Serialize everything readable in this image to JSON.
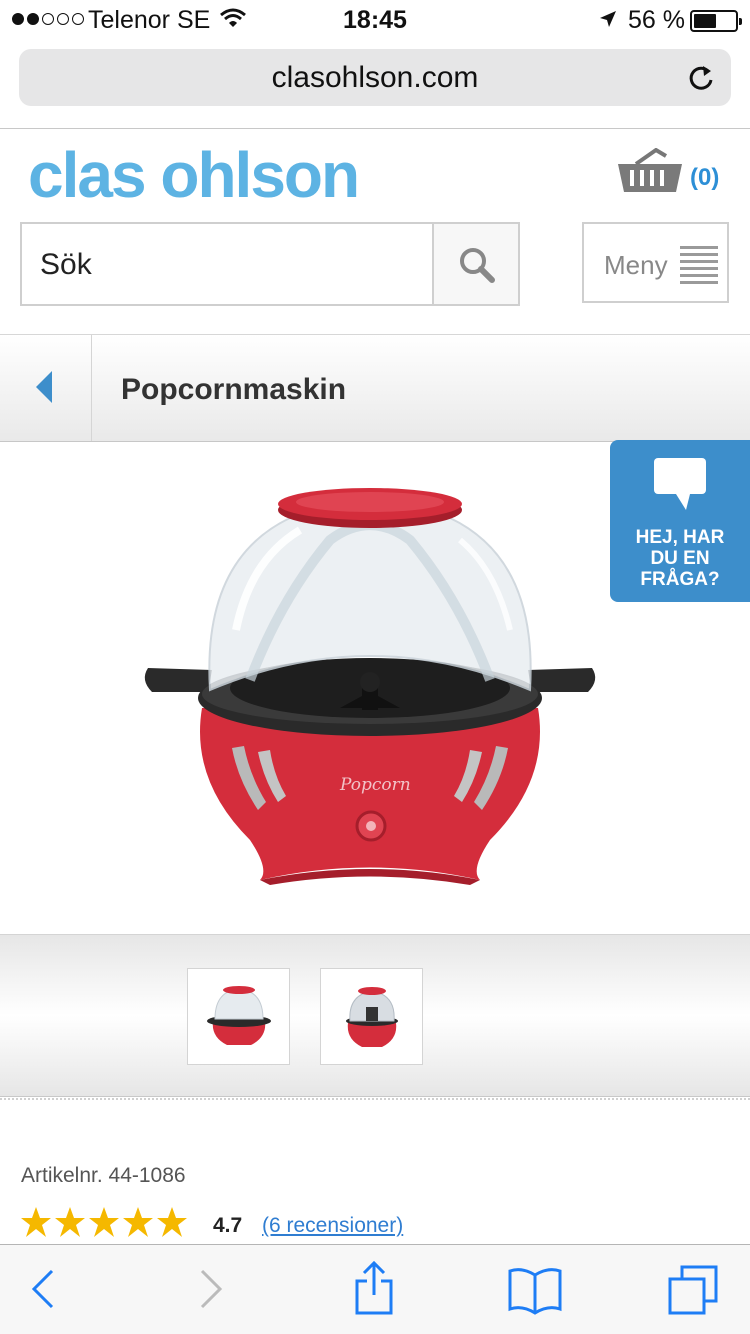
{
  "status_bar": {
    "carrier": "Telenor SE",
    "time": "18:45",
    "battery": "56 %",
    "battery_level": 0.56
  },
  "browser": {
    "url": "clasohlson.com"
  },
  "header": {
    "logo": "clas ohlson",
    "cart_count": "(0)",
    "search_placeholder": "Sök",
    "menu_label": "Meny"
  },
  "breadcrumb": {
    "title": "Popcornmaskin"
  },
  "product": {
    "brand_script": "Popcorn"
  },
  "chat_widget": {
    "text_line1": "HEJ, HAR",
    "text_line2": "DU EN",
    "text_line3": "FRÅGA?"
  },
  "details": {
    "article_number": "Artikelnr. 44-1086",
    "rating_value": "4.7",
    "rating_stars": 5,
    "reviews_link": "(6 recensioner)"
  },
  "colors": {
    "brand_blue": "#5db3e3",
    "link_blue": "#2f7dd1",
    "chat_blue": "#3d8ecb",
    "star_yellow": "#f5b800",
    "product_red": "#d42d3c"
  },
  "icons": [
    "wifi-icon",
    "location-icon",
    "battery-icon",
    "reload-icon",
    "cart-icon",
    "search-icon",
    "menu-icon",
    "back-icon",
    "chat-icon",
    "star-icon",
    "safari-back-icon",
    "safari-forward-icon",
    "share-icon",
    "bookmarks-icon",
    "tabs-icon"
  ]
}
